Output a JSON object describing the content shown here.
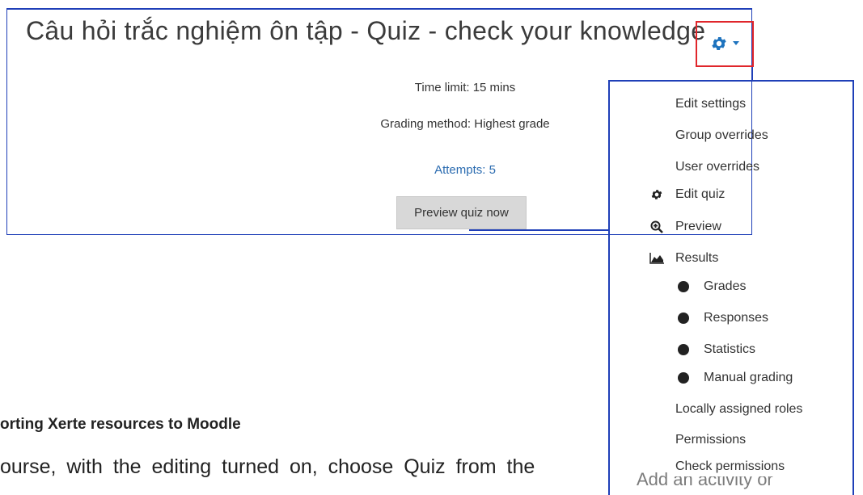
{
  "quiz": {
    "title": "Câu hỏi trắc nghiệm ôn tập - Quiz - check your knowledge",
    "time_limit": "Time limit: 15 mins",
    "grading_method": "Grading method: Highest grade",
    "attempts": "Attempts: 5",
    "preview_button": "Preview quiz now"
  },
  "menu": {
    "items": [
      {
        "label": "Edit settings",
        "icon": ""
      },
      {
        "label": "Group overrides",
        "icon": ""
      },
      {
        "label": "User overrides",
        "icon": ""
      },
      {
        "label": "Edit quiz",
        "icon": "gear-icon"
      },
      {
        "label": "Preview",
        "icon": "zoom-in-icon"
      },
      {
        "label": "Results",
        "icon": "area-chart-icon"
      },
      {
        "label": "Grades",
        "icon": "bullet"
      },
      {
        "label": "Responses",
        "icon": "bullet"
      },
      {
        "label": "Statistics",
        "icon": "bullet"
      },
      {
        "label": "Manual grading",
        "icon": "bullet"
      },
      {
        "label": "Locally assigned roles",
        "icon": ""
      },
      {
        "label": "Permissions",
        "icon": ""
      },
      {
        "label": "Check permissions",
        "icon": ""
      }
    ]
  },
  "document": {
    "heading": "orting Xerte resources to Moodle",
    "paragraph": "ourse, with the editing turned on, choose Quiz from the",
    "paragraph_tail": "Add an activity or"
  },
  "colors": {
    "outline_blue": "#1f3fb8",
    "highlight_red": "#e0262b",
    "link_blue": "#2a6bb0",
    "gear_blue": "#1e73be"
  }
}
